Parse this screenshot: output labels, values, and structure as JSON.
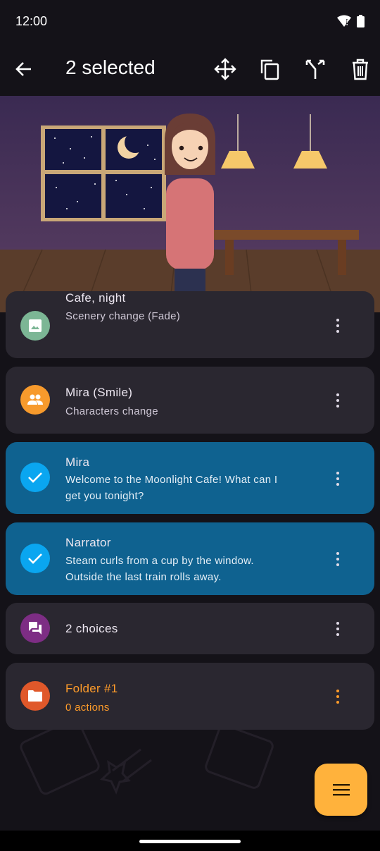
{
  "status": {
    "time": "12:00"
  },
  "app_bar": {
    "title": "2 selected"
  },
  "items": [
    {
      "name": "Cafe, night",
      "sub": "Scenery change (Fade)",
      "icon": "image-icon",
      "color": "#7cb695",
      "selected": false
    },
    {
      "name": "Mira (Smile)",
      "sub": "Characters change",
      "icon": "people-icon",
      "color": "#f79a2c",
      "selected": false
    },
    {
      "name": "Mira",
      "sub_line1": "Welcome to the Moonlight Cafe! What can I",
      "sub_line2": "get you tonight?",
      "icon": "check-icon",
      "color": "#0aa6f0",
      "selected": true
    },
    {
      "name": "Narrator",
      "sub_line1": "Steam curls from a cup by the window.",
      "sub_line2": "Outside the last train rolls away.",
      "icon": "check-icon",
      "color": "#0aa6f0",
      "selected": true
    },
    {
      "name": "2 choices",
      "icon": "chat-icon",
      "color": "#7d2d84",
      "selected": false
    },
    {
      "name": "Folder #1",
      "sub": "0 actions",
      "icon": "folder-icon",
      "color": "#e0582a",
      "selected": false
    }
  ],
  "colors": {
    "accent": "#ffb23c",
    "selected_card": "#0f6290",
    "card": "#2a2730",
    "background": "#141218"
  }
}
